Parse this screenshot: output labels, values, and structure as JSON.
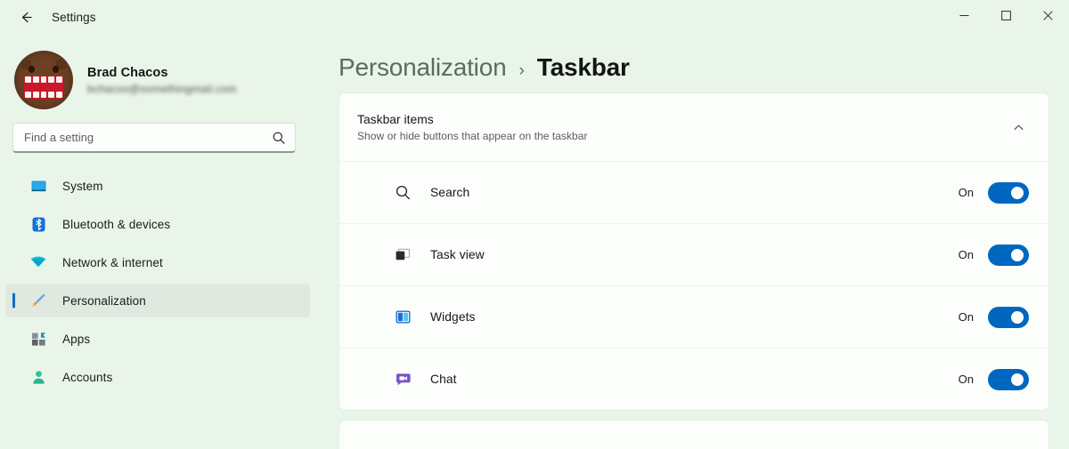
{
  "window": {
    "title": "Settings",
    "back_icon": "back-arrow-icon",
    "controls": {
      "minimize": "─",
      "maximize": "☐",
      "close": "✕"
    }
  },
  "account": {
    "name": "Brad Chacos",
    "email": "bchacos@somethingmail.com",
    "avatar_alt": "domo-kun-avatar"
  },
  "search": {
    "placeholder": "Find a setting",
    "value": "",
    "icon": "search-icon"
  },
  "sidebar": {
    "items": [
      {
        "label": "System",
        "icon": "monitor-icon",
        "selected": false
      },
      {
        "label": "Bluetooth & devices",
        "icon": "bluetooth-icon",
        "selected": false
      },
      {
        "label": "Network & internet",
        "icon": "wifi-icon",
        "selected": false
      },
      {
        "label": "Personalization",
        "icon": "paintbrush-icon",
        "selected": true
      },
      {
        "label": "Apps",
        "icon": "apps-grid-icon",
        "selected": false
      },
      {
        "label": "Accounts",
        "icon": "person-icon",
        "selected": false
      }
    ]
  },
  "breadcrumb": {
    "parent": "Personalization",
    "separator": "›",
    "current": "Taskbar"
  },
  "card": {
    "title": "Taskbar items",
    "subtitle": "Show or hide buttons that appear on the taskbar",
    "collapse_icon": "chevron-up-icon",
    "rows": [
      {
        "label": "Search",
        "icon": "search-icon",
        "state": "On",
        "on": true
      },
      {
        "label": "Task view",
        "icon": "task-view-icon",
        "state": "On",
        "on": true
      },
      {
        "label": "Widgets",
        "icon": "widgets-icon",
        "state": "On",
        "on": true
      },
      {
        "label": "Chat",
        "icon": "chat-bubble-icon",
        "state": "On",
        "on": true
      }
    ]
  },
  "colors": {
    "page_background": "#eaf5ea",
    "card_background": "#fbfefb",
    "accent_toggle": "#0067c0",
    "selection_pill": "#0f6cbd",
    "selected_row": "#dfe9df"
  }
}
